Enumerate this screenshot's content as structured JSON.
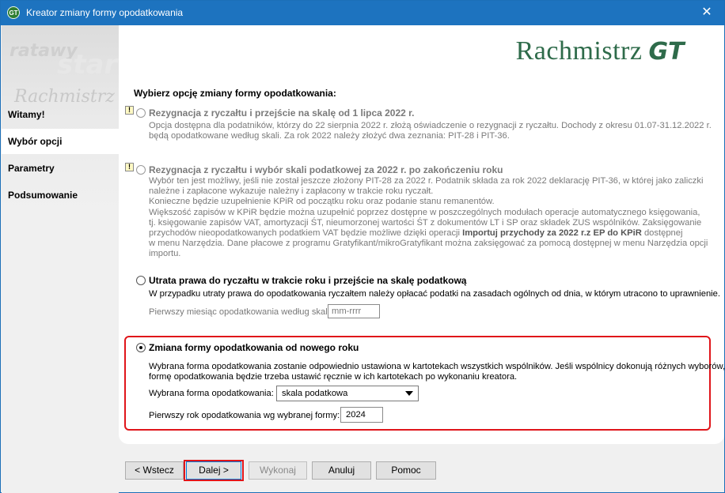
{
  "window": {
    "title": "Kreator zmiany formy opodatkowania",
    "icon_label": "GT"
  },
  "sidebar": {
    "watermark": [
      "ratawy",
      "start",
      "Rachmistrz"
    ],
    "items": [
      {
        "label": "Witamy!"
      },
      {
        "label": "Wybór opcji"
      },
      {
        "label": "Parametry"
      },
      {
        "label": "Podsumowanie"
      }
    ]
  },
  "logo": {
    "text": "Rachmistrz",
    "suffix": "GT"
  },
  "main": {
    "heading": "Wybierz opcję zmiany formy opodatkowania:",
    "options": [
      {
        "title": "Rezygnacja z ryczałtu i przejście na skalę od 1 lipca 2022 r.",
        "lines": [
          "Opcja dostępna dla podatników, którzy do 22 sierpnia 2022 r. złożą oświadczenie o rezygnacji z ryczałtu. Dochody z okresu 01.07-31.12.2022 r.",
          "będą opodatkowane według skali. Za rok 2022 należy złożyć dwa zeznania: PIT-28 i PIT-36."
        ]
      },
      {
        "title": "Rezygnacja z ryczałtu i wybór skali podatkowej za 2022 r. po zakończeniu roku",
        "lines": [
          "Wybór ten jest możliwy, jeśli nie został jeszcze złożony PIT-28 za 2022 r. Podatnik składa za rok 2022 deklarację PIT-36, w której jako zaliczki",
          "należne i zapłacone wykazuje należny i zapłacony w trakcie roku ryczałt.",
          "Konieczne będzie uzupełnienie KPiR od początku roku oraz podanie stanu remanentów.",
          "Większość zapisów w KPiR będzie można uzupełnić poprzez dostępne w poszczególnych modułach operacje automatycznego księgowania,",
          "tj. księgowanie zapisów VAT, amortyzacji ŚT, nieumorzonej wartości ŚT z dokumentów LT i SP oraz składek ZUS wspólników. Zaksięgowanie",
          "przychodów nieopodatkowanych podatkiem VAT będzie możliwe dzięki operacji ",
          "w menu Narzędzia. Dane płacowe z programu Gratyfikant/mikroGratyfikant można zaksięgować za pomocą dostępnej w menu Narzędzia opcji",
          "importu."
        ],
        "line6_bold": "Importuj przychody za 2022 r.z EP do KPiR",
        "line6_tail": " dostępnej"
      },
      {
        "title": "Utrata prawa do ryczałtu w trakcie roku i przejście na skalę podatkową",
        "lines": [
          "W przypadku utraty prawa do opodatkowania ryczałtem należy opłacać podatki na zasadach ogólnych od dnia, w którym utracono to uprawnienie."
        ],
        "field_label": "Pierwszy miesiąc opodatkowania według skali:",
        "field_placeholder": "mm-rrrr"
      },
      {
        "title": "Zmiana formy opodatkowania od nowego roku",
        "lines": [
          "Wybrana forma opodatkowania zostanie odpowiednio ustawiona w kartotekach wszystkich wspólników. Jeśli wspólnicy dokonują różnych wyborów,",
          "formę opodatkowania będzie trzeba ustawić ręcznie w ich kartotekach po wykonaniu kreatora."
        ],
        "select_label": "Wybrana forma opodatkowania:",
        "select_value": "skala podatkowa",
        "year_label": "Pierwszy rok opodatkowania wg wybranej formy:",
        "year_value": "2024"
      }
    ]
  },
  "buttons": {
    "back": "< Wstecz",
    "next": "Dalej >",
    "execute": "Wykonaj",
    "cancel": "Anuluj",
    "help": "Pomoc"
  },
  "colors": {
    "titlebar": "#1d73bf",
    "highlight": "#e0151a",
    "logo": "#2e6b4a"
  }
}
